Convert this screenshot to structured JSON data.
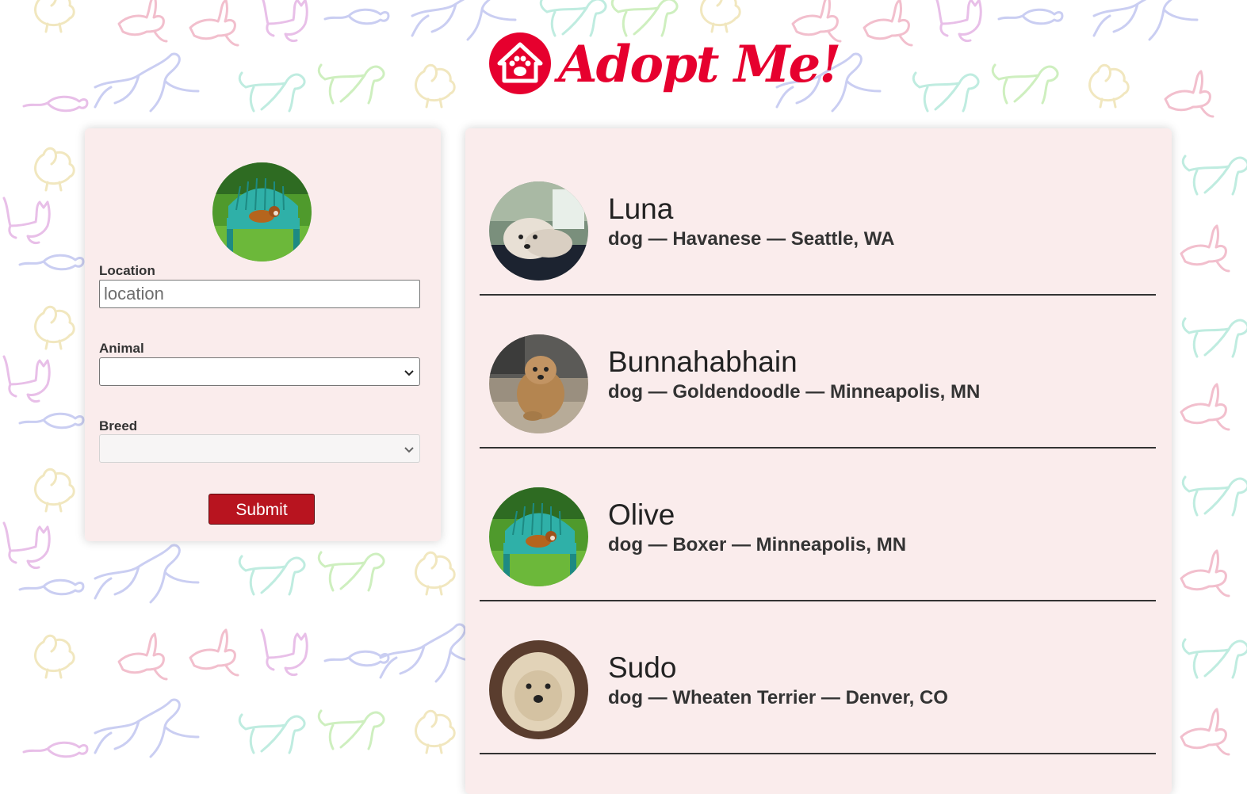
{
  "brand": {
    "logo_text": "Adopt Me!",
    "accent_color": "#e6002e",
    "logo_icon": "home-paw-icon"
  },
  "search": {
    "location_label": "Location",
    "location_placeholder": "location",
    "location_value": "",
    "animal_label": "Animal",
    "animal_value": "",
    "breed_label": "Breed",
    "breed_value": "",
    "breed_disabled": true,
    "submit_label": "Submit",
    "submit_color": "#b8141f",
    "preview_image": "dog-on-green-bench-photo"
  },
  "results": [
    {
      "name": "Luna",
      "description": "dog — Havanese — Seattle, WA",
      "image": "white-havanese-dog-photo"
    },
    {
      "name": "Bunnahabhain",
      "description": "dog — Goldendoodle — Minneapolis, MN",
      "image": "goldendoodle-dog-photo"
    },
    {
      "name": "Olive",
      "description": "dog — Boxer — Minneapolis, MN",
      "image": "dog-on-green-bench-photo"
    },
    {
      "name": "Sudo",
      "description": "dog — Wheaten Terrier — Denver, CO",
      "image": "wheaten-terrier-dog-photo"
    }
  ],
  "colors": {
    "panel_background": "#faecec",
    "text": "#333333"
  }
}
